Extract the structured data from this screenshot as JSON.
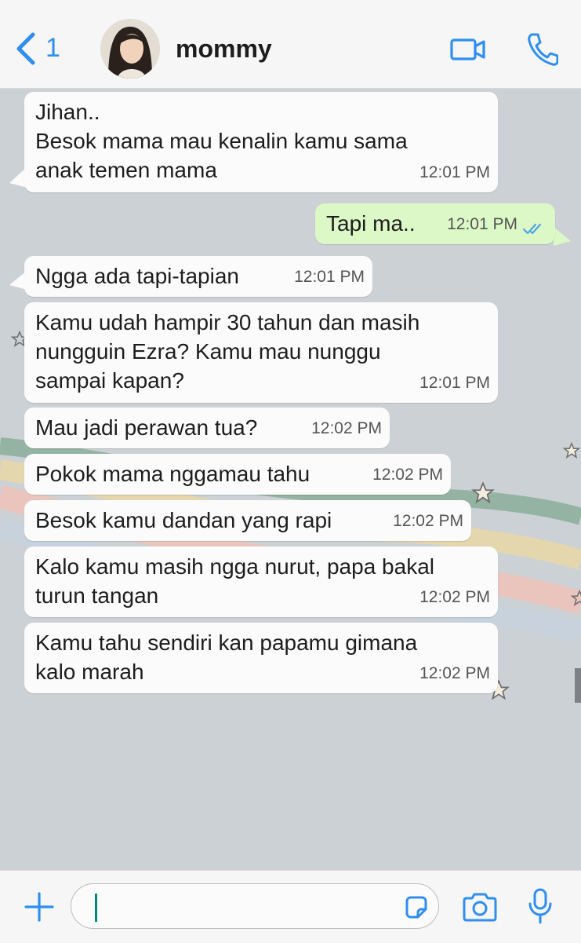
{
  "header": {
    "back_count": "1",
    "contact_name": "mommy",
    "icons": [
      "back-chevron-icon",
      "avatar",
      "video-call-icon",
      "phone-call-icon"
    ]
  },
  "accent_color": "#2f8ef0",
  "messages": [
    {
      "direction": "in",
      "text": "Jihan..\nBesok mama mau kenalin kamu sama\nanak temen mama",
      "time": "12:01 PM"
    },
    {
      "direction": "out",
      "text": "Tapi ma..",
      "time": "12:01 PM",
      "status": "read"
    },
    {
      "direction": "in",
      "text": "Ngga ada tapi-tapian",
      "time": "12:01 PM"
    },
    {
      "direction": "in",
      "text": "Kamu udah hampir 30 tahun dan masih\nnungguin Ezra? Kamu mau nunggu\nsampai kapan?",
      "time": "12:01 PM"
    },
    {
      "direction": "in",
      "text": "Mau jadi perawan tua?",
      "time": "12:02 PM"
    },
    {
      "direction": "in",
      "text": "Pokok mama nggamau tahu",
      "time": "12:02 PM"
    },
    {
      "direction": "in",
      "text": "Besok kamu dandan yang rapi",
      "time": "12:02 PM"
    },
    {
      "direction": "in",
      "text": "Kalo kamu masih ngga nurut, papa bakal\nturun tangan",
      "time": "12:02 PM"
    },
    {
      "direction": "in",
      "text": "Kamu tahu sendiri kan papamu gimana\nkalo marah",
      "time": "12:02 PM"
    }
  ],
  "input": {
    "value": "",
    "icons": [
      "plus-icon",
      "sticker-icon",
      "camera-icon",
      "microphone-icon"
    ]
  }
}
